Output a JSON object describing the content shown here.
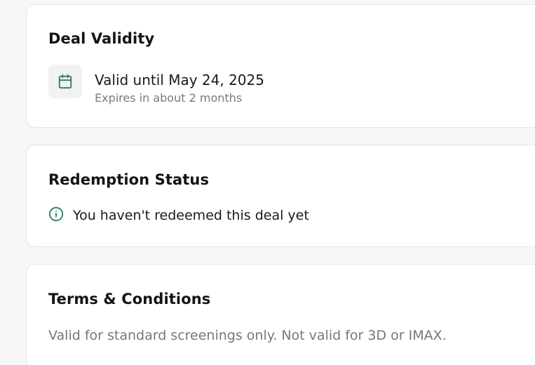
{
  "deal_validity": {
    "title": "Deal Validity",
    "icon": "calendar-icon",
    "valid_until": "Valid until May 24, 2025",
    "expires_hint": "Expires in about 2 months"
  },
  "redemption_status": {
    "title": "Redemption Status",
    "icon": "info-icon",
    "message": "You haven't redeemed this deal yet"
  },
  "terms": {
    "title": "Terms & Conditions",
    "text": "Valid for standard screenings only. Not valid for 3D or IMAX."
  },
  "colors": {
    "accent": "#2e7d62",
    "muted_text": "#7a7a7a",
    "card_border": "#e5e5e5"
  }
}
